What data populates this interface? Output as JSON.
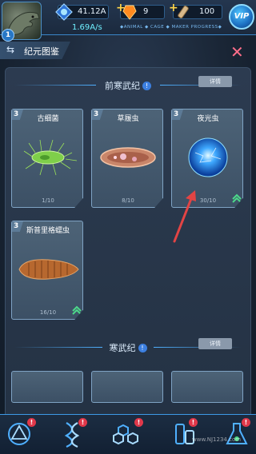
{
  "topbar": {
    "level": "1",
    "coins": "41.12A",
    "rate": "1.69A/s",
    "gems": "9",
    "items": "100",
    "tagline": "◆ANIMAL ◆ CAGE ◆ MAKER PROGRESS◆",
    "vip_label": "VIP"
  },
  "header": {
    "title": "纪元图鉴",
    "swap_icon": "swap-icon",
    "close_icon": "close-icon"
  },
  "sections": [
    {
      "name": "前寒武纪",
      "detail_label": "详情"
    },
    {
      "name": "寒武纪",
      "detail_label": "详情"
    }
  ],
  "cards": [
    {
      "level": "3",
      "name": "古细菌",
      "count": "1/10",
      "upgradable": false,
      "icon": "archaea-bacterium"
    },
    {
      "level": "3",
      "name": "草履虫",
      "count": "8/10",
      "upgradable": false,
      "icon": "paramecium"
    },
    {
      "level": "3",
      "name": "夜光虫",
      "count": "30/10",
      "upgradable": true,
      "icon": "noctiluca-glow"
    },
    {
      "level": "3",
      "name": "斯普里格蠕虫",
      "count": "16/10",
      "upgradable": true,
      "icon": "spriggina-worm"
    }
  ],
  "nav_icons": [
    "portal-icon",
    "dna-icon",
    "molecule-icon",
    "lab-icon",
    "flask-icon"
  ],
  "alert_mark": "!",
  "watermark": "www.NJ1234.com",
  "colors": {
    "accent": "#4fb0ff",
    "alert": "#e0384a",
    "upgrade": "#4cd98a",
    "arrow": "#e24444"
  }
}
